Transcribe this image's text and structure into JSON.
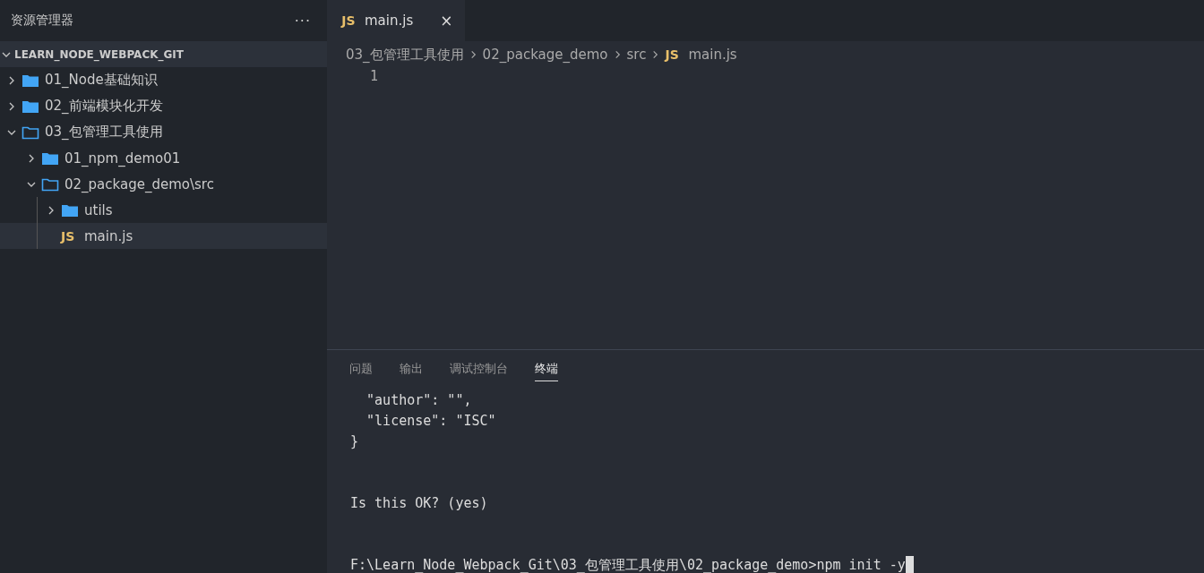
{
  "sidebar": {
    "title": "资源管理器",
    "more": "···",
    "root": {
      "label": "LEARN_NODE_WEBPACK_GIT",
      "expanded": true
    },
    "tree": [
      {
        "kind": "folder",
        "label": "01_Node基础知识",
        "expanded": false,
        "selected": false
      },
      {
        "kind": "folder",
        "label": "02_前端模块化开发",
        "expanded": false,
        "selected": false
      },
      {
        "kind": "folder",
        "label": "03_包管理工具使用",
        "expanded": true,
        "selected": false,
        "children": [
          {
            "kind": "folder",
            "label": "01_npm_demo01",
            "expanded": false,
            "selected": false
          },
          {
            "kind": "folder",
            "label": "02_package_demo\\src",
            "expanded": true,
            "selected": false,
            "children": [
              {
                "kind": "folder",
                "label": "utils",
                "expanded": false,
                "selected": false
              },
              {
                "kind": "file",
                "icon_text": "JS",
                "label": "main.js",
                "selected": true
              }
            ]
          }
        ]
      }
    ]
  },
  "editor": {
    "tabs": [
      {
        "icon_text": "JS",
        "label": "main.js",
        "close": "×",
        "selected": true
      }
    ],
    "breadcrumb": [
      {
        "kind": "text",
        "label": "03_包管理工具使用"
      },
      {
        "kind": "text",
        "label": "02_package_demo"
      },
      {
        "kind": "text",
        "label": "src"
      },
      {
        "kind": "file",
        "icon_text": "JS",
        "label": "main.js"
      }
    ],
    "line_numbers": [
      "1"
    ]
  },
  "panel": {
    "tabs": [
      {
        "label": "问题",
        "selected": false
      },
      {
        "label": "输出",
        "selected": false
      },
      {
        "label": "调试控制台",
        "selected": false
      },
      {
        "label": "终端",
        "selected": true
      }
    ],
    "terminal": [
      {
        "kind": "output",
        "lines": [
          "  \"author\": \"\",",
          "  \"license\": \"ISC\"",
          "}"
        ]
      },
      {
        "kind": "output",
        "lines": [
          "Is this OK? (yes)"
        ]
      },
      {
        "kind": "prompt",
        "lines": [
          "F:\\Learn_Node_Webpack_Git\\03_包管理工具使用\\02_package_demo>npm init -y"
        ],
        "cursor": true
      }
    ]
  }
}
